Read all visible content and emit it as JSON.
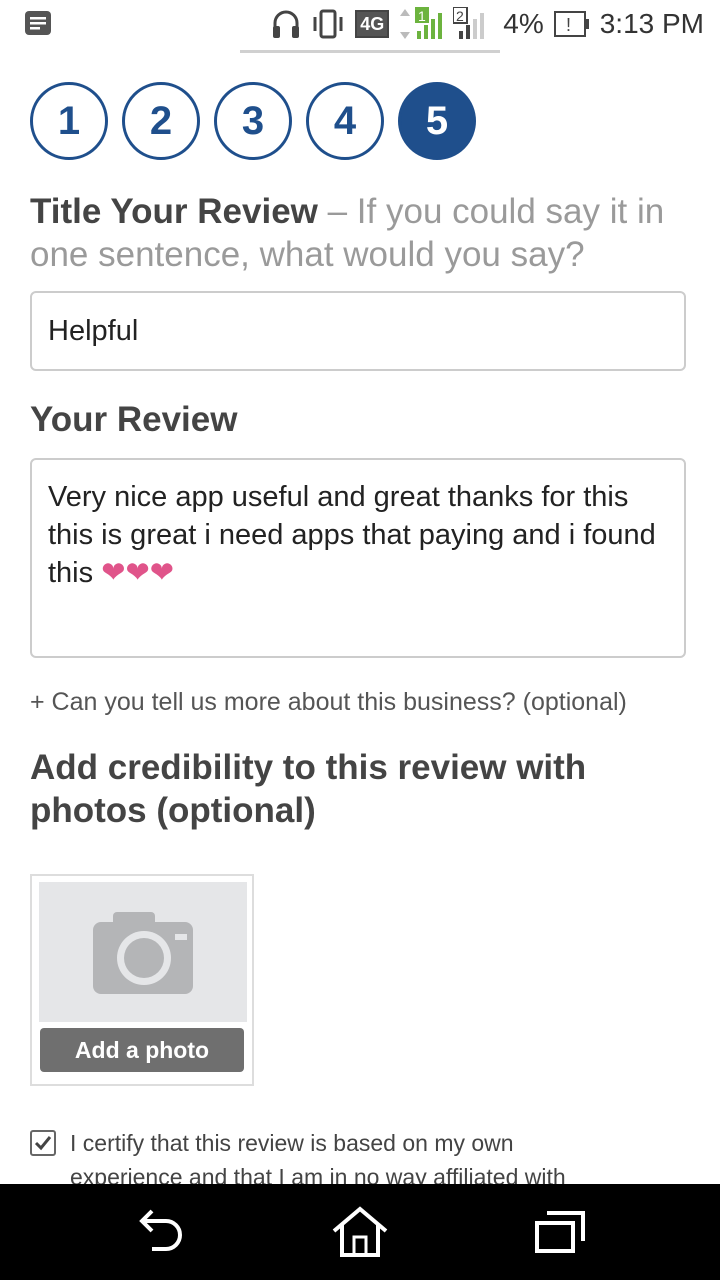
{
  "status_bar": {
    "network": "4G",
    "signal_1_badge": "1",
    "signal_2_badge": "2",
    "battery": "4%",
    "time": "3:13 PM"
  },
  "steps": [
    "1",
    "2",
    "3",
    "4",
    "5"
  ],
  "active_step": "5",
  "title_section": {
    "label_bold": "Title Your Review",
    "label_hint": " – If you could say it in one sentence, what would you say?",
    "value": "Helpful"
  },
  "review_section": {
    "label": "Your Review",
    "value": "Very nice app useful and great thanks for this this is great i need apps that paying and i found this ",
    "hearts": "❤❤❤"
  },
  "more_link": "+ Can you tell us more about this business? (optional)",
  "photos": {
    "heading": "Add credibility to this review with photos (optional)",
    "button_label": "Add a photo"
  },
  "certify": {
    "checked": true,
    "text": "I certify that this review is based on my own experience and that I am in no way affiliated with"
  },
  "colors": {
    "accent": "#1f4f8c",
    "heart": "#e0548a",
    "button_gray": "#6f6f6f"
  },
  "icons": [
    "notification-icon",
    "headphones-icon",
    "vibrate-icon",
    "signal-icon",
    "battery-alert-icon",
    "camera-icon",
    "checkbox-icon",
    "back-icon",
    "home-icon",
    "recents-icon"
  ]
}
